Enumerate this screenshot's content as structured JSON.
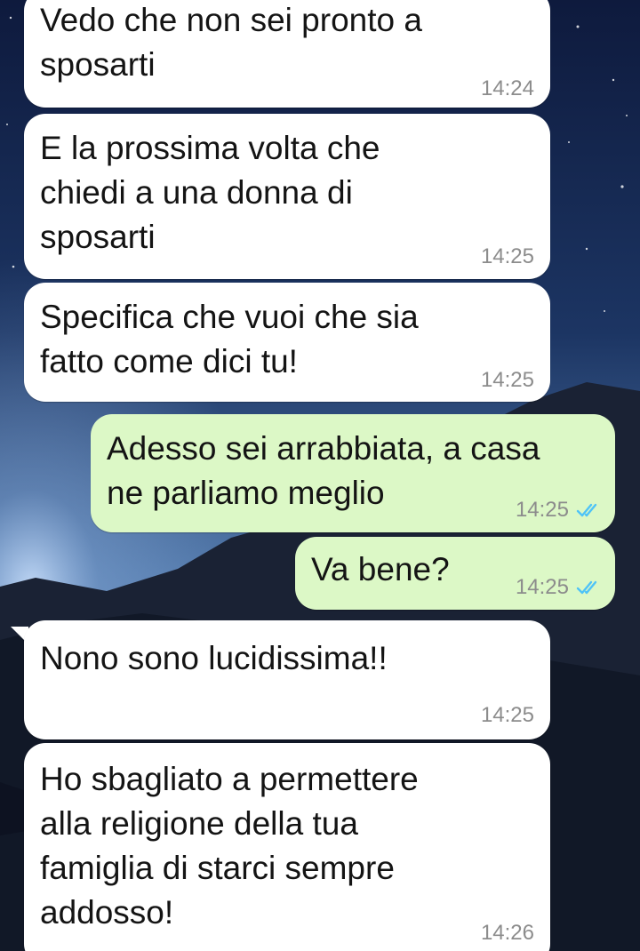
{
  "chat": {
    "messages": [
      {
        "direction": "incoming",
        "text": "Vedo che non sei pronto a\nsposarti",
        "time": "14:24"
      },
      {
        "direction": "incoming",
        "text": "E la prossima volta che\nchiedi a una donna di\nsposarti",
        "time": "14:25"
      },
      {
        "direction": "incoming",
        "text": "Specifica che vuoi che sia\nfatto come dici tu!",
        "time": "14:25"
      },
      {
        "direction": "outgoing",
        "text": "Adesso sei arrabbiata, a casa\nne parliamo meglio",
        "time": "14:25",
        "status": "read"
      },
      {
        "direction": "outgoing",
        "text": "Va bene?",
        "time": "14:25",
        "status": "read"
      },
      {
        "direction": "incoming",
        "text": "Nono sono lucidissima!!",
        "time": "14:25"
      },
      {
        "direction": "incoming",
        "text": "Ho sbagliato a permettere\nalla religione della tua\nfamiglia di starci sempre\naddosso!",
        "time": "14:26"
      }
    ]
  },
  "colors": {
    "incoming_bubble": "#ffffff",
    "outgoing_bubble": "#dcf8c6",
    "read_ticks": "#4fc3f7",
    "timestamp": "#8c8c8c"
  },
  "icons": {
    "read_receipt": "double-check-icon"
  }
}
